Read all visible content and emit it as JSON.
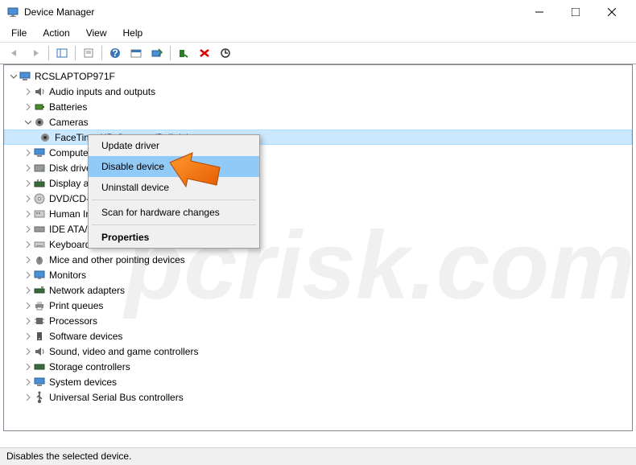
{
  "window": {
    "title": "Device Manager"
  },
  "menu": {
    "file": "File",
    "action": "Action",
    "view": "View",
    "help": "Help"
  },
  "tree": {
    "root": "RCSLAPTOP971F",
    "nodes": {
      "audio": "Audio inputs and outputs",
      "batteries": "Batteries",
      "cameras": "Cameras",
      "camera_child": "FaceTime HD Camera (Built-in)",
      "computer": "Computer",
      "disk": "Disk drives",
      "display": "Display adapters",
      "dvd": "DVD/CD-ROM drives",
      "hid": "Human Interface Devices",
      "ide": "IDE ATA/ATAPI controllers",
      "keyboards": "Keyboards",
      "mice": "Mice and other pointing devices",
      "monitors": "Monitors",
      "network": "Network adapters",
      "printqueues": "Print queues",
      "processors": "Processors",
      "software": "Software devices",
      "sound": "Sound, video and game controllers",
      "storage": "Storage controllers",
      "system": "System devices",
      "usb": "Universal Serial Bus controllers"
    }
  },
  "context_menu": {
    "update_driver": "Update driver",
    "disable_device": "Disable device",
    "uninstall_device": "Uninstall device",
    "scan": "Scan for hardware changes",
    "properties": "Properties"
  },
  "statusbar": {
    "text": "Disables the selected device."
  },
  "watermark": "pcrisk.com"
}
